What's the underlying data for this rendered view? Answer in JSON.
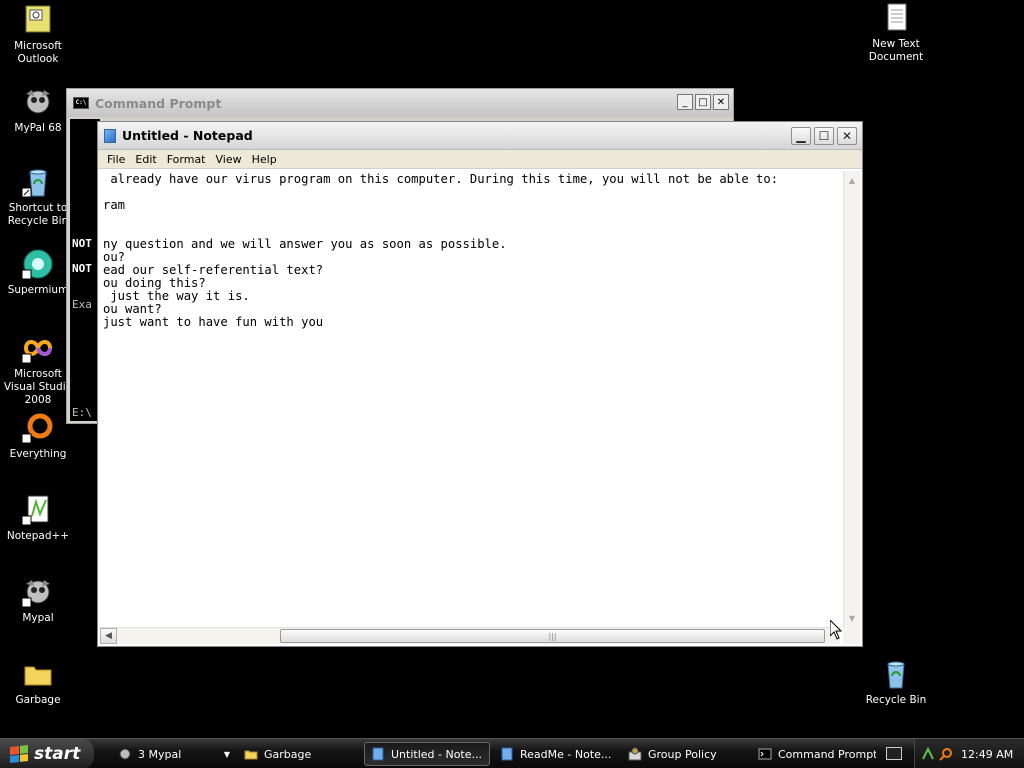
{
  "desktop": {
    "icons_left": [
      {
        "label": "Microsoft Outlook",
        "icon": "outlook-icon"
      },
      {
        "label": "MyPal 68",
        "icon": "mypal-icon"
      },
      {
        "label": "Shortcut to Recycle Bin",
        "icon": "recycle-bin-icon"
      },
      {
        "label": "Supermium",
        "icon": "supermium-icon"
      },
      {
        "label": "Microsoft Visual Studio 2008",
        "icon": "visual-studio-icon"
      },
      {
        "label": "Everything",
        "icon": "everything-icon"
      },
      {
        "label": "Notepad++",
        "icon": "notepadpp-icon"
      },
      {
        "label": "Mypal",
        "icon": "mypal-icon"
      },
      {
        "label": "Garbage",
        "icon": "folder-icon"
      }
    ],
    "icons_right": [
      {
        "label": "New Text Document",
        "icon": "text-document-icon"
      },
      {
        "label": "Recycle Bin",
        "icon": "recycle-bin-icon"
      }
    ]
  },
  "cmd_window": {
    "title": "Command Prompt",
    "visible_lines": [
      "NOT",
      "NOT",
      "Exa",
      "E:\\"
    ]
  },
  "notepad": {
    "title": "Untitled - Notepad",
    "menu": [
      "File",
      "Edit",
      "Format",
      "View",
      "Help"
    ],
    "lines": [
      " already have our virus program on this computer. During this time, you will not be able to:",
      "",
      "ram",
      "",
      "",
      "ny question and we will answer you as soon as possible.",
      "ou?",
      "ead our self-referential text?",
      "ou doing this?",
      " just the way it is.",
      "ou want?",
      "just want to have fun with you"
    ]
  },
  "taskbar": {
    "start_label": "start",
    "tasks": [
      {
        "label": "3 Mypal",
        "icon": "mypal-icon",
        "active": false
      },
      {
        "label": "Garbage",
        "icon": "folder-icon",
        "active": false
      },
      {
        "label": "Untitled - Note...",
        "icon": "notepad-icon",
        "active": true
      },
      {
        "label": "ReadMe - Note...",
        "icon": "notepad-icon",
        "active": false
      },
      {
        "label": "Group Policy",
        "icon": "group-policy-icon",
        "active": false
      },
      {
        "label": "Command Prompt",
        "icon": "cmd-icon",
        "active": false
      }
    ],
    "clock": "12:49 AM"
  }
}
